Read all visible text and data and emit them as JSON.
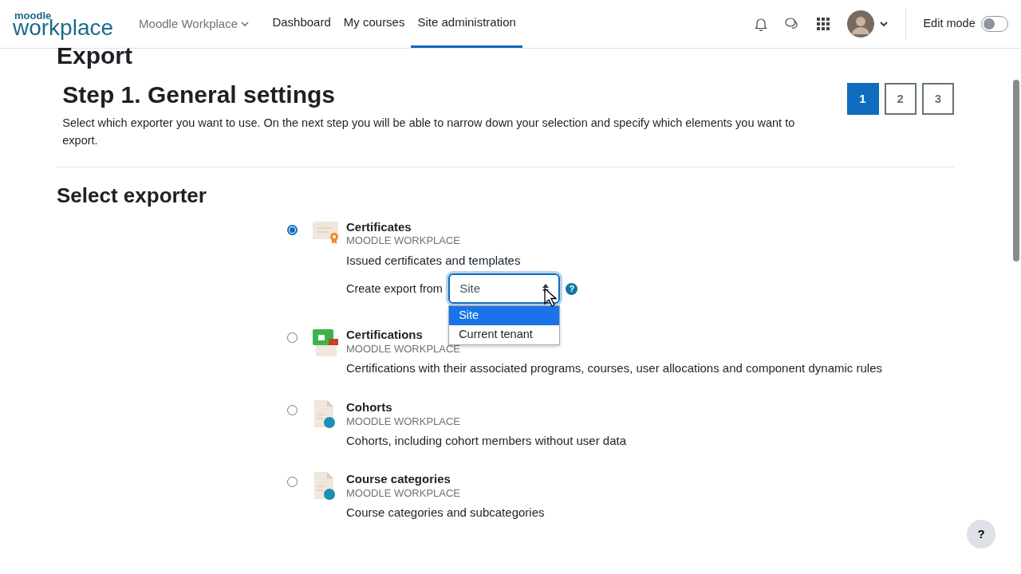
{
  "navbar": {
    "logo_top": "moodle",
    "logo_bottom": "workplace",
    "tenant_menu": "Moodle Workplace",
    "links": [
      {
        "label": "Dashboard",
        "selected": false
      },
      {
        "label": "My courses",
        "selected": false
      },
      {
        "label": "Site administration",
        "selected": true
      }
    ],
    "edit_mode": {
      "label": "Edit mode",
      "on": false
    }
  },
  "page_title": "Export",
  "step": {
    "title": "Step 1. General settings",
    "description": "Select which exporter you want to use. On the next step you will be able to narrow down your selection and specify which elements you want to export.",
    "steps": [
      {
        "label": "1",
        "selected": true
      },
      {
        "label": "2",
        "selected": false
      },
      {
        "label": "3",
        "selected": false
      }
    ]
  },
  "section_title": "Select exporter",
  "exporters": [
    {
      "kind": "certificate",
      "title": "Certificates",
      "source": "MOODLE WORKPLACE",
      "description": "Issued certificates and templates",
      "selected": true,
      "export_from": {
        "label": "Create export from",
        "value": "Site",
        "help": "?",
        "expanded": true,
        "options": [
          {
            "label": "Site",
            "selected": true
          },
          {
            "label": "Current tenant",
            "selected": false
          }
        ]
      }
    },
    {
      "kind": "certification",
      "title": "Certifications",
      "source": "MOODLE WORKPLACE",
      "description": "Certifications with their associated programs, courses, user allocations and component dynamic rules",
      "selected": false
    },
    {
      "kind": "document",
      "title": "Cohorts",
      "source": "MOODLE WORKPLACE",
      "description": "Cohorts, including cohort members without user data",
      "selected": false
    },
    {
      "kind": "document",
      "title": "Course categories",
      "source": "MOODLE WORKPLACE",
      "description": "Course categories and subcategories",
      "selected": false
    }
  ],
  "help_button": "?"
}
